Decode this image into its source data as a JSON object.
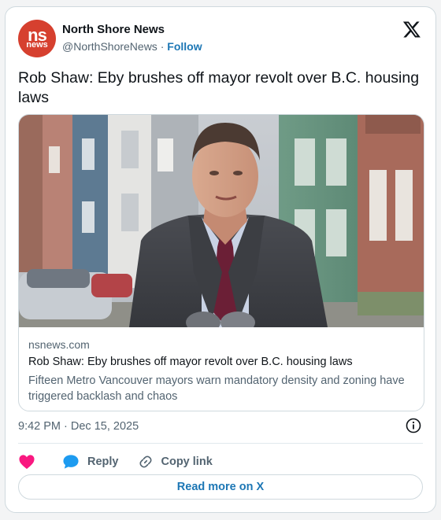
{
  "post": {
    "author_name": "North Shore News",
    "handle": "@NorthShoreNews",
    "separator": "·",
    "follow_label": "Follow",
    "avatar_text_top": "ns",
    "avatar_text_bottom": "news",
    "text": "Rob Shaw: Eby brushes off mayor revolt over B.C. housing laws",
    "timestamp": "9:42 PM · Dec 15, 2025"
  },
  "link_card": {
    "domain": "nsnews.com",
    "title": "Rob Shaw: Eby brushes off mayor revolt over B.C. housing laws",
    "description": "Fifteen Metro Vancouver mayors warn mandatory density and zoning have triggered backlash and chaos"
  },
  "actions": {
    "reply_label": "Reply",
    "copy_label": "Copy link",
    "read_more_label": "Read more on X"
  },
  "colors": {
    "accent": "#1d77b5",
    "heart": "#f91880",
    "reply_bubble": "#1d9bf0",
    "brand_red": "#d6402f"
  },
  "icons": [
    "x-logo-icon",
    "info-icon",
    "heart-icon",
    "reply-icon",
    "link-icon"
  ]
}
